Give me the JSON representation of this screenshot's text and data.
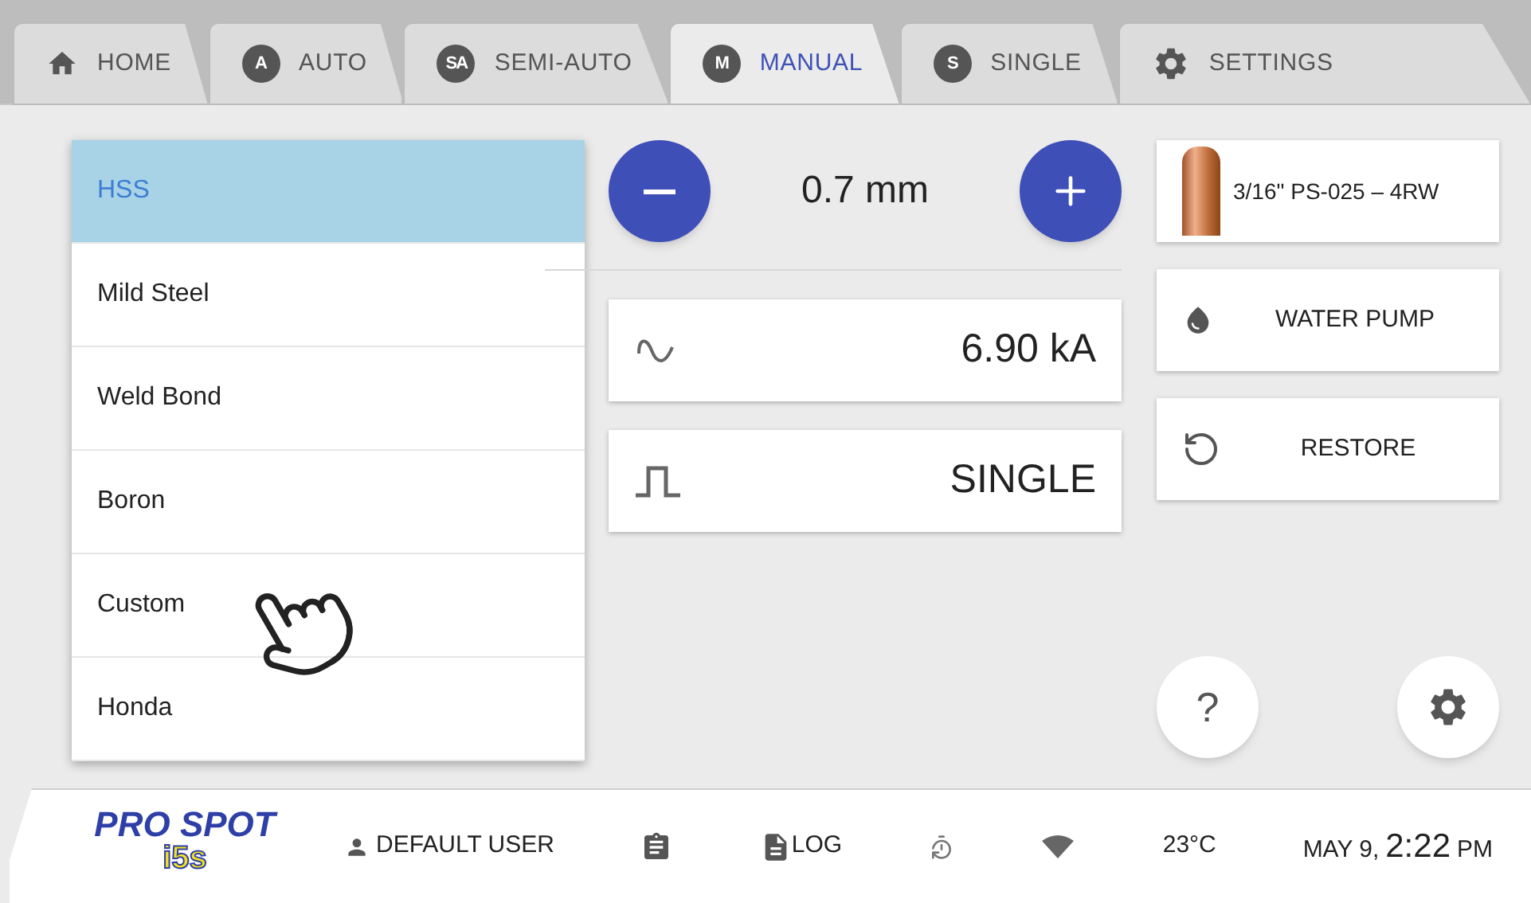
{
  "tabs": [
    {
      "label": "HOME",
      "kind": "home",
      "selected": false
    },
    {
      "label": "AUTO",
      "kind": "letter",
      "letter": "A",
      "selected": false
    },
    {
      "label": "SEMI-AUTO",
      "kind": "letter",
      "letter": "SA",
      "selected": false
    },
    {
      "label": "MANUAL",
      "kind": "letter",
      "letter": "M",
      "selected": true
    },
    {
      "label": "SINGLE",
      "kind": "letter",
      "letter": "S",
      "selected": false
    },
    {
      "label": "SETTINGS",
      "kind": "gear",
      "selected": false
    }
  ],
  "material_menu": [
    {
      "label": "HSS",
      "selected": true
    },
    {
      "label": "Mild Steel",
      "selected": false
    },
    {
      "label": "Weld Bond",
      "selected": false
    },
    {
      "label": "Boron",
      "selected": false
    },
    {
      "label": "Custom",
      "selected": false
    },
    {
      "label": "Honda",
      "selected": false
    }
  ],
  "thickness": {
    "value": "0.7 mm"
  },
  "readouts": [
    {
      "kind": "wave",
      "value": "6.90 kA"
    },
    {
      "kind": "pulse",
      "value": "SINGLE"
    }
  ],
  "right_buttons": [
    {
      "kind": "electrode",
      "label": "3/16\" PS-025 – 4RW"
    },
    {
      "kind": "drop",
      "label": "WATER PUMP"
    },
    {
      "kind": "restore",
      "label": "RESTORE"
    }
  ],
  "help_button": {
    "label": "?"
  },
  "footer": {
    "logo_top": "PRO SPOT",
    "logo_bottom": "i5s",
    "user": "DEFAULT USER",
    "log": "LOG",
    "temperature": "23°C",
    "date": "MAY 9,",
    "time": "2:22",
    "ampm": "PM"
  }
}
